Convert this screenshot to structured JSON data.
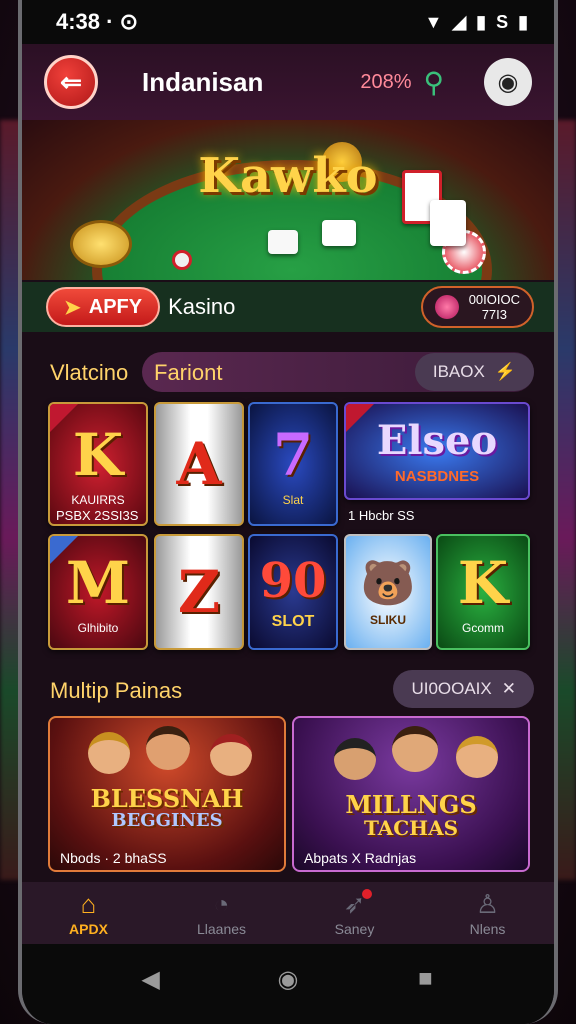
{
  "status_bar": {
    "time": "4:38 · ⊙",
    "battery_text": "S"
  },
  "header": {
    "title": "Indanisan",
    "balance": "208%",
    "colors": {
      "brand": "#d8202a"
    }
  },
  "hero": {
    "title": "Kawko"
  },
  "promo": {
    "app_label": "APFY",
    "label": "Kasino",
    "code_line1": "00IOIOC",
    "code_line2": "77I3"
  },
  "section1": {
    "title": "Vlatcino",
    "subtitle": "Fariont",
    "filter_label": "IBAOX",
    "games_row1": [
      {
        "symbol": "K",
        "label": "KAUIRRS",
        "caption": "PSBX 2SSI3S"
      },
      {
        "symbol": "A",
        "label": "",
        "caption": ""
      },
      {
        "symbol": "7",
        "label": "Slat",
        "caption": ""
      },
      {
        "symbol": "Elseo",
        "label": "NASBDNES",
        "caption": "1 Hbcbr SS"
      }
    ],
    "games_row2": [
      {
        "symbol": "M",
        "label": "Glhibito",
        "caption": ""
      },
      {
        "symbol": "Z",
        "label": "",
        "caption": ""
      },
      {
        "symbol": "90",
        "label": "SLOT",
        "caption": ""
      },
      {
        "symbol": "🐻",
        "label": "SLIKU",
        "caption": ""
      },
      {
        "symbol": "K",
        "label": "Gcomm",
        "caption": ""
      }
    ]
  },
  "section2": {
    "title": "Multip Painas",
    "filter_label": "UI0OOAIX",
    "cards": [
      {
        "title_line1": "BLESSNAH",
        "title_line2": "BEGGINES",
        "caption": "Nbods · 2 bhaSS"
      },
      {
        "title_line1": "MILLNGS",
        "title_line2": "TACHAS",
        "caption": "Abpats X Radnjas"
      }
    ]
  },
  "bottom_nav": [
    {
      "label": "APDX",
      "icon": "home-icon",
      "active": true
    },
    {
      "label": "Llaanes",
      "icon": "timer-icon",
      "active": false
    },
    {
      "label": "Saney",
      "icon": "rocket-icon",
      "active": false
    },
    {
      "label": "Nlens",
      "icon": "user-icon",
      "active": false
    }
  ]
}
